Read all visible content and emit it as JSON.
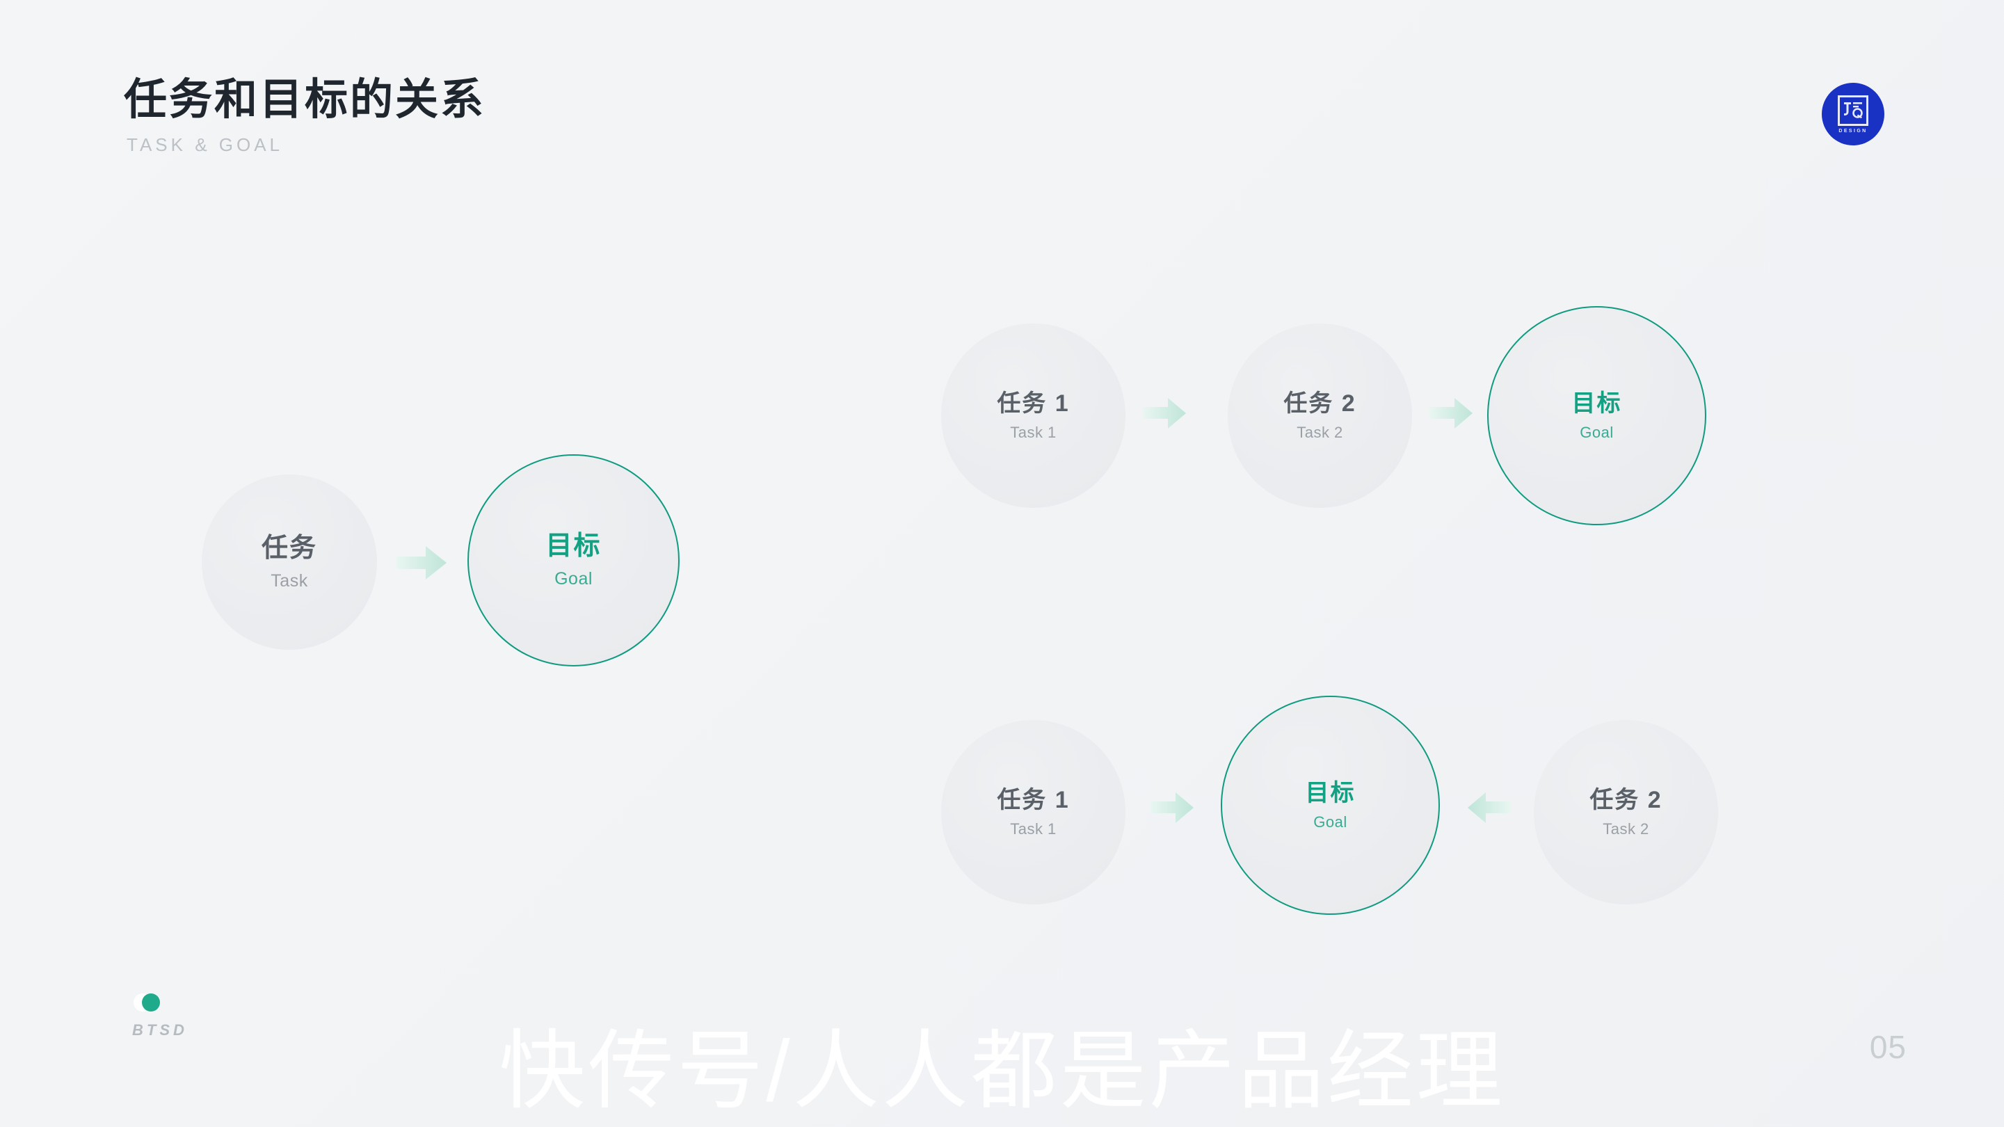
{
  "header": {
    "title": "任务和目标的关系",
    "subtitle": "TASK & GOAL"
  },
  "brand_logo": {
    "monogram": "JQ",
    "word": "DESIGN",
    "color": "#1a32c4"
  },
  "colors": {
    "background": "#f2f4f6",
    "task_fill": "#eaecef",
    "goal_accent": "#109b81",
    "goal_text": "#12a182",
    "goal_subtext": "#3aab93",
    "task_text": "#5a6068",
    "task_subtext": "#9aa0a6",
    "arrow_light": "#e7f5ef",
    "arrow_dark": "#bfe5d8",
    "title_text": "#1f262e",
    "subtitle_text": "#bcc1c6"
  },
  "diagrams": [
    {
      "id": "single-task-to-goal",
      "nodes": [
        {
          "id": "task",
          "type": "task",
          "cn": "任务",
          "en": "Task"
        },
        {
          "id": "goal",
          "type": "goal",
          "cn": "目标",
          "en": "Goal"
        }
      ],
      "arrows": [
        {
          "id": "task-to-goal",
          "direction": "right"
        }
      ]
    },
    {
      "id": "sequential-tasks-to-goal",
      "nodes": [
        {
          "id": "task1",
          "type": "task",
          "cn": "任务 1",
          "en": "Task 1"
        },
        {
          "id": "task2",
          "type": "task",
          "cn": "任务 2",
          "en": "Task 2"
        },
        {
          "id": "goal",
          "type": "goal",
          "cn": "目标",
          "en": "Goal"
        }
      ],
      "arrows": [
        {
          "id": "task1-to-task2",
          "direction": "right"
        },
        {
          "id": "task2-to-goal",
          "direction": "right"
        }
      ]
    },
    {
      "id": "converging-tasks-to-goal",
      "nodes": [
        {
          "id": "task1",
          "type": "task",
          "cn": "任务 1",
          "en": "Task 1"
        },
        {
          "id": "goal",
          "type": "goal",
          "cn": "目标",
          "en": "Goal"
        },
        {
          "id": "task2",
          "type": "task",
          "cn": "任务 2",
          "en": "Task 2"
        }
      ],
      "arrows": [
        {
          "id": "task1-to-goal",
          "direction": "right"
        },
        {
          "id": "task2-to-goal",
          "direction": "left"
        }
      ]
    }
  ],
  "footer": {
    "brand_word": "BTSD"
  },
  "page_number": "05",
  "watermark": "快传号/人人都是产品经理"
}
